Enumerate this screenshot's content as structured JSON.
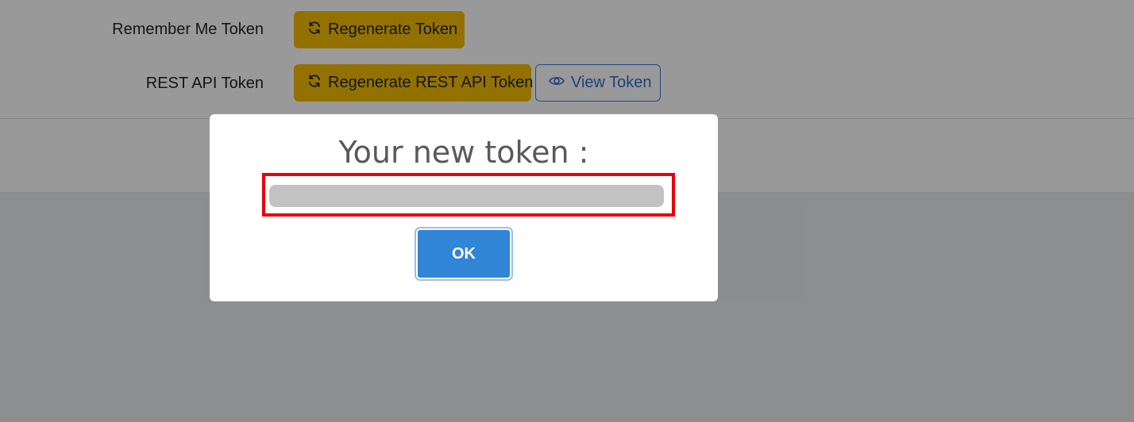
{
  "settings": {
    "rows": [
      {
        "label": "Remember Me Token",
        "buttons": [
          {
            "label": "Regenerate Token",
            "icon": "refresh-icon"
          }
        ]
      },
      {
        "label": "REST API Token",
        "buttons": [
          {
            "label": "Regenerate REST API Token",
            "icon": "refresh-icon"
          },
          {
            "label": "View Token",
            "icon": "eye-icon"
          }
        ]
      }
    ]
  },
  "modal": {
    "title": "Your new token :",
    "token_value": "",
    "ok_label": "OK"
  },
  "colors": {
    "warning": "#f5bd00",
    "primary": "#3085d6",
    "outline_primary": "#3b7ddd",
    "highlight": "#e8000b",
    "overlay": "rgba(0,0,0,0.4)"
  }
}
